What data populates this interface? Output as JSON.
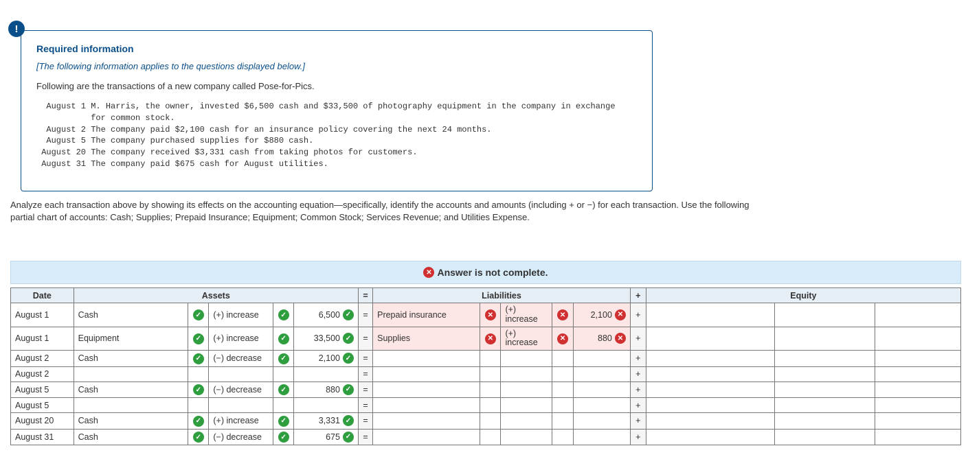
{
  "badge": "!",
  "info": {
    "title": "Required information",
    "subtitle": "[The following information applies to the questions displayed below.]",
    "lead": "Following are the transactions of a new company called Pose-for-Pics.",
    "mono": "  August 1 M. Harris, the owner, invested $6,500 cash and $33,500 of photography equipment in the company in exchange\n           for common stock.\n  August 2 The company paid $2,100 cash for an insurance policy covering the next 24 months.\n  August 5 The company purchased supplies for $880 cash.\n August 20 The company received $3,331 cash from taking photos for customers.\n August 31 The company paid $675 cash for August utilities."
  },
  "instructions": "Analyze each transaction above by showing its effects on the accounting equation—specifically, identify the accounts and amounts (including + or −) for each transaction. Use the following partial chart of accounts: Cash; Supplies; Prepaid Insurance; Equipment; Common Stock; Services Revenue; and Utilities Expense.",
  "status": {
    "text": "Answer is not complete."
  },
  "headers": {
    "date": "Date",
    "assets": "Assets",
    "eq": "=",
    "liabilities": "Liabilities",
    "plus": "+",
    "equity": "Equity"
  },
  "rows": [
    {
      "date": "August 1",
      "a_acct": "Cash",
      "a_acct_ok": true,
      "a_sign": "(+) increase",
      "a_sign_ok": true,
      "a_amt": "6,500",
      "a_amt_ok": true,
      "eq": "=",
      "l_acct": "Prepaid insurance",
      "l_acct_bad": true,
      "l_sign": "(+) increase",
      "l_sign_bad": true,
      "l_amt": "2,100",
      "l_amt_bad": true,
      "plus": "+"
    },
    {
      "date": "August 1",
      "a_acct": "Equipment",
      "a_acct_ok": true,
      "a_sign": "(+) increase",
      "a_sign_ok": true,
      "a_amt": "33,500",
      "a_amt_ok": true,
      "eq": "=",
      "l_acct": "Supplies",
      "l_acct_bad": true,
      "l_sign": "(+) increase",
      "l_sign_bad": true,
      "l_amt": "880",
      "l_amt_bad": true,
      "plus": "+"
    },
    {
      "date": "August 2",
      "a_acct": "Cash",
      "a_acct_ok": true,
      "a_sign": "(−) decrease",
      "a_sign_ok": true,
      "a_amt": "2,100",
      "a_amt_ok": true,
      "eq": "=",
      "plus": "+"
    },
    {
      "date": "August 2",
      "eq": "=",
      "plus": "+"
    },
    {
      "date": "August 5",
      "a_acct": "Cash",
      "a_acct_ok": true,
      "a_sign": "(−) decrease",
      "a_sign_ok": true,
      "a_amt": "880",
      "a_amt_ok": true,
      "eq": "=",
      "plus": "+"
    },
    {
      "date": "August 5",
      "eq": "=",
      "plus": "+"
    },
    {
      "date": "August 20",
      "a_acct": "Cash",
      "a_acct_ok": true,
      "a_sign": "(+) increase",
      "a_sign_ok": true,
      "a_amt": "3,331",
      "a_amt_ok": true,
      "eq": "=",
      "plus": "+"
    },
    {
      "date": "August 31",
      "a_acct": "Cash",
      "a_acct_ok": true,
      "a_sign": "(−) decrease",
      "a_sign_ok": true,
      "a_amt": "675",
      "a_amt_ok": true,
      "eq": "=",
      "plus": "+"
    }
  ]
}
